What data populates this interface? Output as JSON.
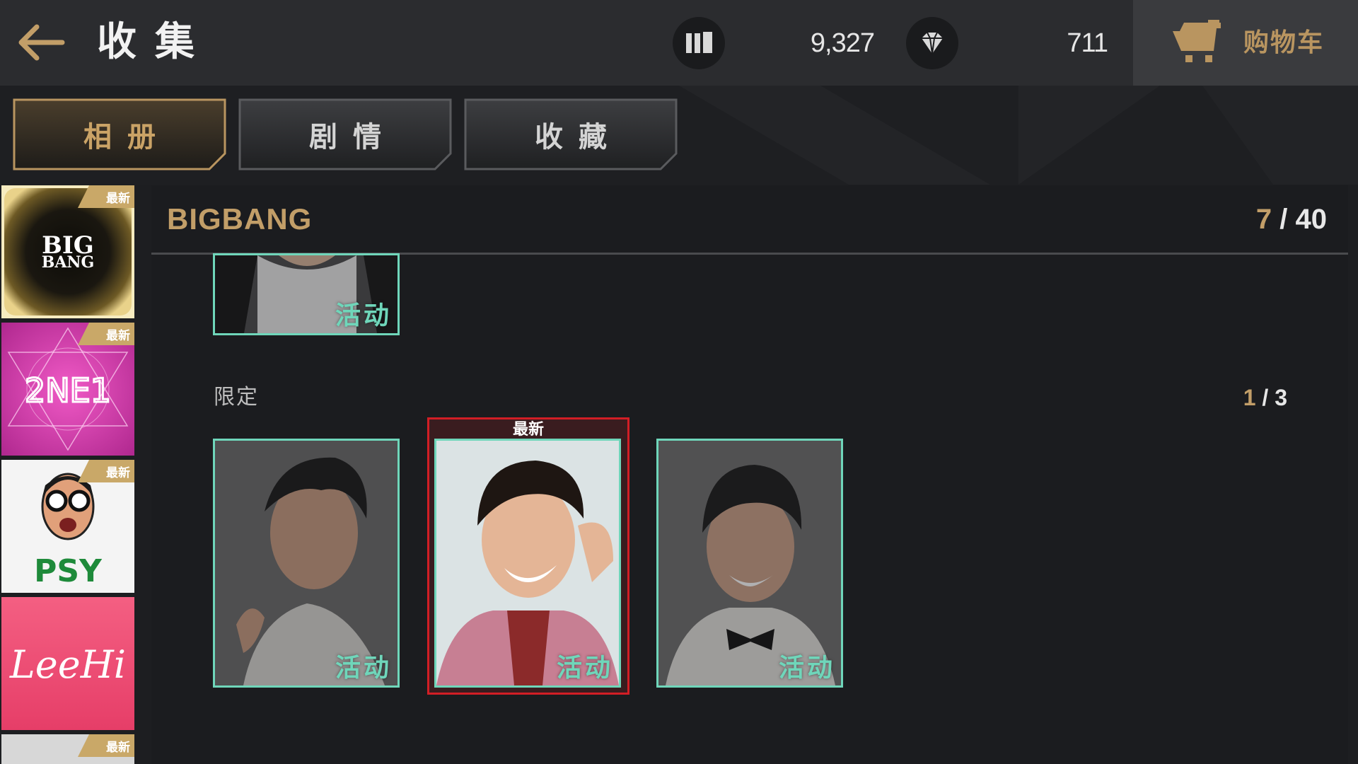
{
  "header": {
    "title": "收集",
    "stat1": {
      "icon": "card-stack-icon",
      "value": "9,327"
    },
    "stat2": {
      "icon": "diamond-icon",
      "value": "711"
    },
    "cart_label": "购物车"
  },
  "tabs": [
    {
      "label": "相册",
      "active": true
    },
    {
      "label": "剧情",
      "active": false
    },
    {
      "label": "收藏",
      "active": false
    }
  ],
  "groups": [
    {
      "name": "BIGBANG",
      "logo_line1": "BIG",
      "logo_line2": "BANG",
      "badge": "最新",
      "selected": true
    },
    {
      "name": "2NE1",
      "logo": "2NE1",
      "badge": "最新"
    },
    {
      "name": "PSY",
      "logo": "PSY",
      "badge": "最新"
    },
    {
      "name": "Lee Hi",
      "logo": "LeeHi",
      "badge": ""
    },
    {
      "name": "",
      "logo": "",
      "badge": "最新"
    }
  ],
  "album": {
    "title": "BIGBANG",
    "collected": "7",
    "sep": "/",
    "total": "40"
  },
  "top_card": {
    "tag": "活动"
  },
  "section": {
    "label": "限定",
    "collected": "1",
    "sep": "/",
    "total": "3"
  },
  "cards": [
    {
      "tag": "活动",
      "is_new": false
    },
    {
      "tag": "活动",
      "is_new": true,
      "new_label": "最新"
    },
    {
      "tag": "活动",
      "is_new": false
    }
  ],
  "colors": {
    "accent_gold": "#c29e68",
    "card_border": "#6fd6ba",
    "new_frame": "#d21e25"
  }
}
